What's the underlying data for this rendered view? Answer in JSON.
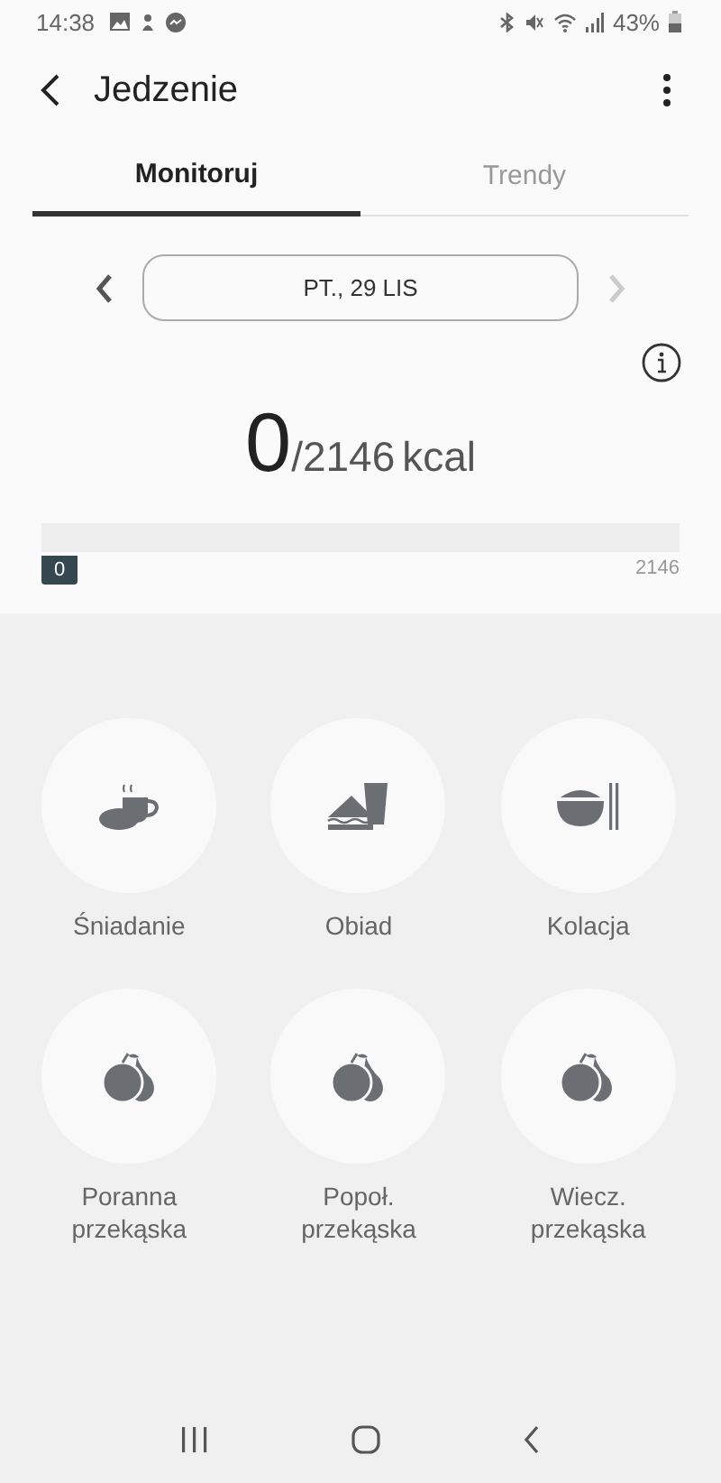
{
  "status_bar": {
    "time": "14:38",
    "battery": "43%"
  },
  "header": {
    "title": "Jedzenie"
  },
  "tabs": [
    {
      "label": "Monitoruj",
      "selected": true
    },
    {
      "label": "Trendy",
      "selected": false
    }
  ],
  "date_nav": {
    "date": "PT., 29 LIS",
    "prev_disabled": false,
    "next_disabled": true
  },
  "calories": {
    "consumed": "0",
    "goal": "/2146",
    "unit": "kcal",
    "marker": "0",
    "max_label": "2146"
  },
  "meals": [
    {
      "kind": "breakfast",
      "label": "Śniadanie"
    },
    {
      "kind": "lunch",
      "label": "Obiad"
    },
    {
      "kind": "dinner",
      "label": "Kolacja"
    },
    {
      "kind": "snack",
      "label": "Poranna\nprzekąska"
    },
    {
      "kind": "snack",
      "label": "Popoł.\nprzekąska"
    },
    {
      "kind": "snack",
      "label": "Wiecz.\nprzekąska"
    }
  ]
}
